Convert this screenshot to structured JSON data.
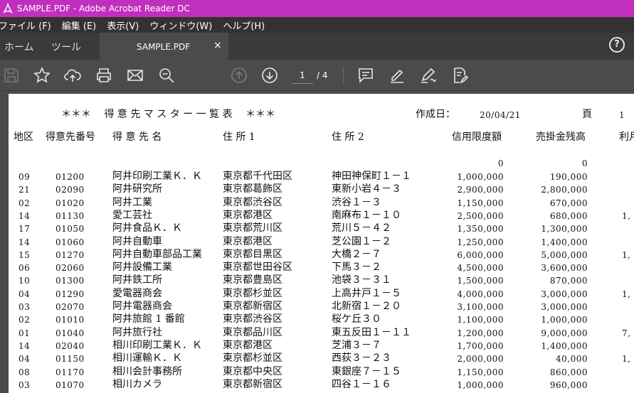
{
  "window": {
    "title": "SAMPLE.PDF - Adobe Acrobat Reader DC"
  },
  "menu": [
    "ファイル (F)",
    "編集 (E)",
    "表示(V)",
    "ウィンドウ(W)",
    "ヘルプ(H)"
  ],
  "tabs": {
    "home": "ホーム",
    "tools": "ツール",
    "document": "SAMPLE.PDF",
    "close": "×"
  },
  "help": "?",
  "toolbar": {
    "page_current": "1",
    "page_total": "/ 4"
  },
  "report": {
    "title": "＊＊＊　 得 意 先 マ ス タ ー 一 覧 表 　＊＊＊",
    "created_label": "作成日：",
    "created_date": "20/04/21",
    "page_label": "頁",
    "page_no": "1",
    "headers": [
      "地区",
      "得意先番号",
      "得 意 先 名",
      "住 所 1",
      "住 所 2",
      "信用限度額",
      "売掛金残高",
      "利月"
    ],
    "zero_a": "0",
    "zero_b": "0",
    "rows": [
      {
        "area": "09",
        "code": "01200",
        "name": "阿井印刷工業Ｋ．Ｋ",
        "addr1": "東京都千代田区",
        "addr2": "神田神保町１－１",
        "limit": "1,000,000",
        "balance": "190,000",
        "extra": ""
      },
      {
        "area": "21",
        "code": "02090",
        "name": "阿井研究所",
        "addr1": "東京都葛飾区",
        "addr2": "東新小岩４－３",
        "limit": "2,900,000",
        "balance": "2,800,000",
        "extra": ""
      },
      {
        "area": "02",
        "code": "01020",
        "name": "阿井工業",
        "addr1": "東京都渋谷区",
        "addr2": "渋谷１－３",
        "limit": "1,150,000",
        "balance": "670,000",
        "extra": ""
      },
      {
        "area": "14",
        "code": "01130",
        "name": "愛工芸社",
        "addr1": "東京都港区",
        "addr2": "南麻布１－１０",
        "limit": "2,500,000",
        "balance": "680,000",
        "extra": "1,"
      },
      {
        "area": "17",
        "code": "01050",
        "name": "阿井食品Ｋ．Ｋ",
        "addr1": "東京都荒川区",
        "addr2": "荒川５－４２",
        "limit": "1,350,000",
        "balance": "1,300,000",
        "extra": ""
      },
      {
        "area": "14",
        "code": "01060",
        "name": "阿井自動車",
        "addr1": "東京都港区",
        "addr2": "芝公園１－２",
        "limit": "1,250,000",
        "balance": "1,400,000",
        "extra": ""
      },
      {
        "area": "15",
        "code": "01270",
        "name": "阿井自動車部品工業",
        "addr1": "東京都目黒区",
        "addr2": "大橋２－７",
        "limit": "6,000,000",
        "balance": "5,000,000",
        "extra": "1,"
      },
      {
        "area": "06",
        "code": "02060",
        "name": "阿井設備工業",
        "addr1": "東京都世田谷区",
        "addr2": "下馬３－２",
        "limit": "4,500,000",
        "balance": "3,600,000",
        "extra": ""
      },
      {
        "area": "10",
        "code": "01300",
        "name": "阿井鉄工所",
        "addr1": "東京都豊島区",
        "addr2": "池袋３－３１",
        "limit": "1,500,000",
        "balance": "870,000",
        "extra": ""
      },
      {
        "area": "04",
        "code": "01290",
        "name": "愛電器商会",
        "addr1": "東京都杉並区",
        "addr2": "上高井戸１－５",
        "limit": "4,000,000",
        "balance": "3,000,000",
        "extra": "1,"
      },
      {
        "area": "03",
        "code": "02070",
        "name": "阿井電器商会",
        "addr1": "東京都新宿区",
        "addr2": "北新宿１－２０",
        "limit": "3,100,000",
        "balance": "3,000,000",
        "extra": ""
      },
      {
        "area": "02",
        "code": "01010",
        "name": "阿井旅館 1 番館",
        "addr1": "東京都渋谷区",
        "addr2": "桜ケ丘３０",
        "limit": "1,100,000",
        "balance": "1,000,000",
        "extra": ""
      },
      {
        "area": "01",
        "code": "01040",
        "name": "阿井旅行社",
        "addr1": "東京都品川区",
        "addr2": "東五反田１－１１",
        "limit": "1,200,000",
        "balance": "9,000,000",
        "extra": "7,"
      },
      {
        "area": "14",
        "code": "02040",
        "name": "相川印刷工業Ｋ．Ｋ",
        "addr1": "東京都港区",
        "addr2": "芝浦３－７",
        "limit": "1,700,000",
        "balance": "1,400,000",
        "extra": ""
      },
      {
        "area": "04",
        "code": "01150",
        "name": "相川運輸Ｋ．Ｋ",
        "addr1": "東京都杉並区",
        "addr2": "西荻３－２３",
        "limit": "2,000,000",
        "balance": "40,000",
        "extra": "1,"
      },
      {
        "area": "08",
        "code": "01170",
        "name": "相川会計事務所",
        "addr1": "東京都中央区",
        "addr2": "東銀座７－１５",
        "limit": "1,150,000",
        "balance": "860,000",
        "extra": ""
      },
      {
        "area": "03",
        "code": "01070",
        "name": "相川カメラ",
        "addr1": "東京都新宿区",
        "addr2": "四谷１－１６",
        "limit": "1,000,000",
        "balance": "960,000",
        "extra": ""
      }
    ]
  }
}
